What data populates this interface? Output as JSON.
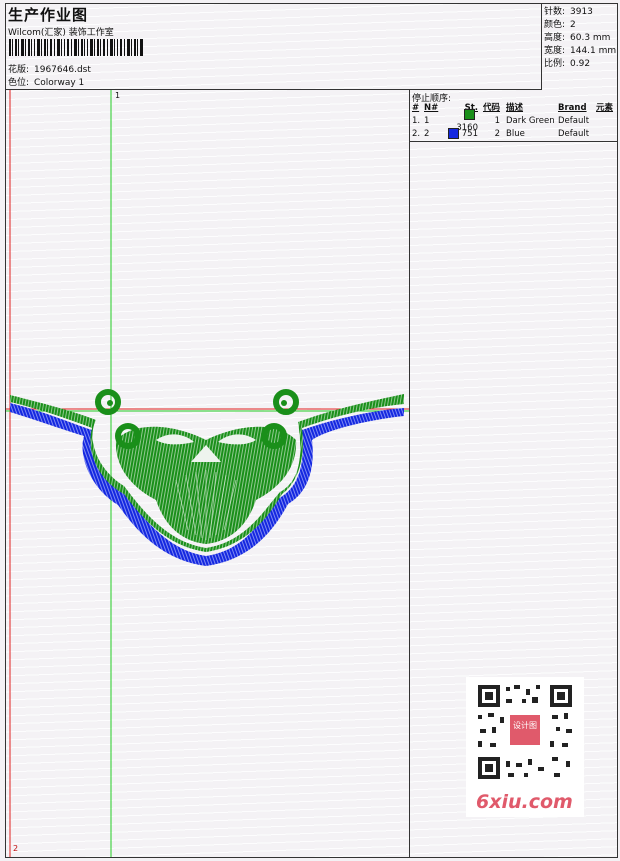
{
  "header": {
    "title": "生产作业图",
    "company": "Wilcom(汇家) 装饰工作室",
    "design_label": "花版:",
    "design_value": "1967646.dst",
    "colorway_label": "色位:",
    "colorway_value": "Colorway 1"
  },
  "stats": [
    {
      "label": "针数:",
      "value": "3913"
    },
    {
      "label": "颜色:",
      "value": "2"
    },
    {
      "label": "高度:",
      "value": "60.3 mm"
    },
    {
      "label": "宽度:",
      "value": "144.1 mm"
    },
    {
      "label": "比例:",
      "value": "0.92"
    }
  ],
  "stop_sequence": {
    "title": "停止顺序:",
    "headers": {
      "hash": "#",
      "num": "N#",
      "stitches": "St.",
      "code": "代码",
      "desc": "描述",
      "brand": "Brand",
      "element": "元素"
    },
    "rows": [
      {
        "index": "1.",
        "num": "1",
        "color": "#1a8f1a",
        "stitches": "3160",
        "code": "1",
        "desc": "Dark Green",
        "brand": "Default"
      },
      {
        "index": "2.",
        "num": "2",
        "color": "#1428e0",
        "stitches": "751",
        "code": "2",
        "desc": "Blue",
        "brand": "Default"
      }
    ]
  },
  "crosshair": {
    "top_label": "1",
    "bottom_label": "2"
  },
  "watermark": {
    "site": "6xiu.com",
    "stamp": "设计图"
  },
  "colors": {
    "green": "#1a8f1a",
    "blue": "#1428e0",
    "red": "#e02020",
    "guide_green": "#22cc22"
  }
}
